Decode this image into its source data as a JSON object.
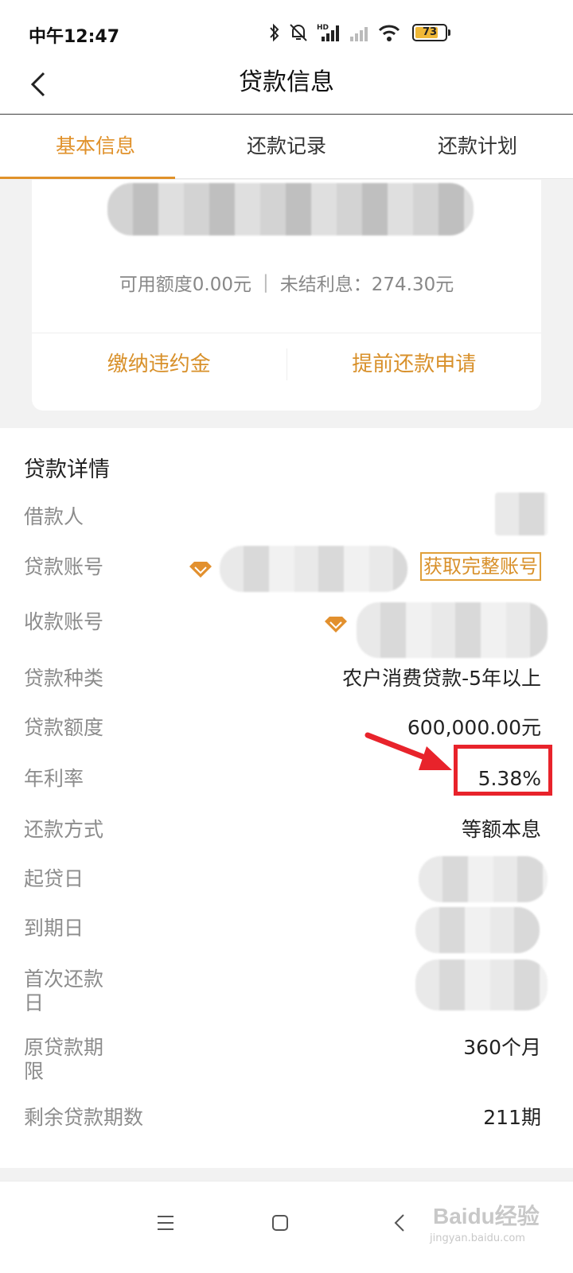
{
  "status_bar": {
    "time": "中午12:47",
    "battery": "73"
  },
  "nav": {
    "title": "贷款信息"
  },
  "tabs": [
    {
      "label": "基本信息",
      "active": true
    },
    {
      "label": "还款记录",
      "active": false
    },
    {
      "label": "还款计划",
      "active": false
    }
  ],
  "summary": {
    "available_credit": "可用额度0.00元",
    "separator": "|",
    "unsettled_interest": "未结利息：274.30元",
    "actions": {
      "pay_penalty": "缴纳违约金",
      "early_repayment": "提前还款申请"
    }
  },
  "details": {
    "title": "贷款详情",
    "borrower_label": "借款人",
    "loan_account_label": "贷款账号",
    "get_full_account": "获取完整账号",
    "receiving_account_label": "收款账号",
    "loan_type_label": "贷款种类",
    "loan_type_value": "农户消费贷款-5年以上",
    "loan_amount_label": "贷款额度",
    "loan_amount_value": "600,000.00元",
    "annual_rate_label": "年利率",
    "annual_rate_value": "5.38%",
    "repayment_method_label": "还款方式",
    "repayment_method_value": "等额本息",
    "start_date_label": "起贷日",
    "due_date_label": "到期日",
    "first_repayment_label": "首次还款日",
    "original_term_label": "原贷款期限",
    "original_term_value": "360个月",
    "remaining_periods_label": "剩余贷款期数",
    "remaining_periods_value": "211期"
  },
  "watermark": {
    "logo": "Baidu经验",
    "sub": "jingyan.baidu.com"
  },
  "colors": {
    "accent": "#e0912a",
    "highlight": "#e8232b"
  }
}
